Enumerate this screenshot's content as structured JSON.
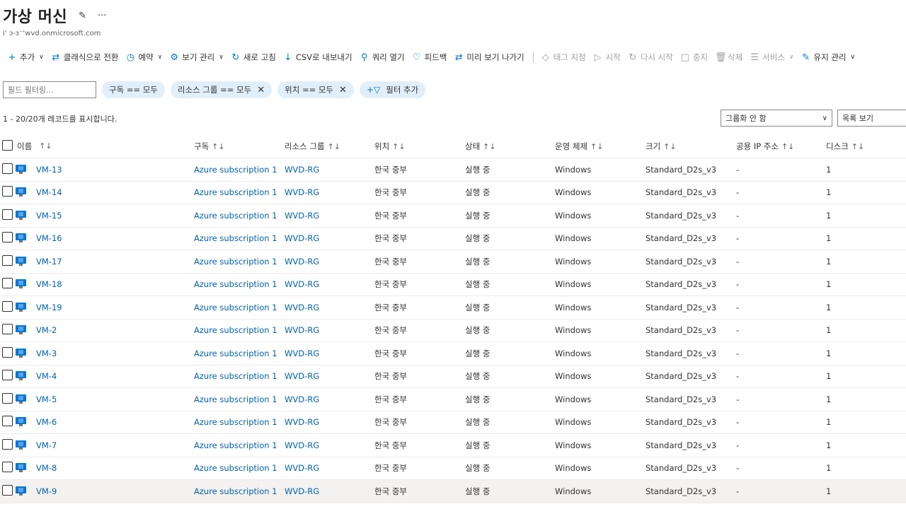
{
  "header": {
    "title": "가상 머신",
    "pin_icon": "pin-icon",
    "more": "···",
    "subtitle": "i' ɔ-ɜ⁻'wvd.onmicrosoft.com"
  },
  "toolbar": {
    "items": [
      {
        "icon": "+",
        "label": "추가",
        "dropdown": true,
        "disabled": false
      },
      {
        "icon": "⇄",
        "label": "클래식으로 전환",
        "dropdown": false,
        "disabled": false
      },
      {
        "icon": "◷",
        "label": "예약",
        "dropdown": true,
        "disabled": false
      },
      {
        "icon": "⚙",
        "label": "보기 관리",
        "dropdown": true,
        "disabled": false
      },
      {
        "icon": "↻",
        "label": "새로 고침",
        "dropdown": false,
        "disabled": false
      },
      {
        "icon": "↓",
        "label": "CSV로 내보내기",
        "dropdown": false,
        "disabled": false
      },
      {
        "icon": "⚲",
        "label": "쿼리 열기",
        "dropdown": false,
        "disabled": false
      },
      {
        "icon": "♡",
        "label": "피드백",
        "dropdown": false,
        "disabled": false
      },
      {
        "icon": "⇄",
        "label": "미리 보기 나가기",
        "dropdown": false,
        "disabled": false
      },
      {
        "icon": "◇",
        "label": "태그 지정",
        "dropdown": false,
        "disabled": true
      },
      {
        "icon": "▷",
        "label": "시작",
        "dropdown": false,
        "disabled": true
      },
      {
        "icon": "↻",
        "label": "다시 시작",
        "dropdown": false,
        "disabled": true
      },
      {
        "icon": "□",
        "label": "중지",
        "dropdown": false,
        "disabled": true
      },
      {
        "icon": "🗑",
        "label": "삭제",
        "dropdown": false,
        "disabled": true
      },
      {
        "icon": "☰",
        "label": "서비스",
        "dropdown": true,
        "disabled": true
      },
      {
        "icon": "✎",
        "label": "유지 관리",
        "dropdown": true,
        "disabled": false
      }
    ]
  },
  "filters": {
    "placeholder": "필드 필터링...",
    "pills": [
      {
        "label": "구독 == 모두",
        "removable": false
      },
      {
        "label": "리소스 그룹 == 모두",
        "removable": true
      },
      {
        "label": "위치 == 모두",
        "removable": true
      }
    ],
    "add_filter": "필터 추가"
  },
  "records_text": "1 - 20/20개 레코드를 표시합니다.",
  "group_by": "그룹화 안 함",
  "view_mode": "목록 보기",
  "columns": [
    "이름",
    "구독",
    "리소스 그룹",
    "위치",
    "상태",
    "운영 체제",
    "크기",
    "공용 IP 주소",
    "디스크"
  ],
  "sort_glyph": "↑↓",
  "rows": [
    {
      "name": "VM-13",
      "sub": "Azure subscription 1",
      "rg": "WVD-RG",
      "loc": "한국 중부",
      "status": "실행 중",
      "os": "Windows",
      "size": "Standard_D2s_v3",
      "ip": "-",
      "disk": "1"
    },
    {
      "name": "VM-14",
      "sub": "Azure subscription 1",
      "rg": "WVD-RG",
      "loc": "한국 중부",
      "status": "실행 중",
      "os": "Windows",
      "size": "Standard_D2s_v3",
      "ip": "-",
      "disk": "1"
    },
    {
      "name": "VM-15",
      "sub": "Azure subscription 1",
      "rg": "WVD-RG",
      "loc": "한국 중부",
      "status": "실행 중",
      "os": "Windows",
      "size": "Standard_D2s_v3",
      "ip": "-",
      "disk": "1"
    },
    {
      "name": "VM-16",
      "sub": "Azure subscription 1",
      "rg": "WVD-RG",
      "loc": "한국 중부",
      "status": "실행 중",
      "os": "Windows",
      "size": "Standard_D2s_v3",
      "ip": "-",
      "disk": "1"
    },
    {
      "name": "VM-17",
      "sub": "Azure subscription 1",
      "rg": "WVD-RG",
      "loc": "한국 중부",
      "status": "실행 중",
      "os": "Windows",
      "size": "Standard_D2s_v3",
      "ip": "-",
      "disk": "1"
    },
    {
      "name": "VM-18",
      "sub": "Azure subscription 1",
      "rg": "WVD-RG",
      "loc": "한국 중부",
      "status": "실행 중",
      "os": "Windows",
      "size": "Standard_D2s_v3",
      "ip": "-",
      "disk": "1"
    },
    {
      "name": "VM-19",
      "sub": "Azure subscription 1",
      "rg": "WVD-RG",
      "loc": "한국 중부",
      "status": "실행 중",
      "os": "Windows",
      "size": "Standard_D2s_v3",
      "ip": "-",
      "disk": "1"
    },
    {
      "name": "VM-2",
      "sub": "Azure subscription 1",
      "rg": "WVD-RG",
      "loc": "한국 중부",
      "status": "실행 중",
      "os": "Windows",
      "size": "Standard_D2s_v3",
      "ip": "-",
      "disk": "1"
    },
    {
      "name": "VM-3",
      "sub": "Azure subscription 1",
      "rg": "WVD-RG",
      "loc": "한국 중부",
      "status": "실행 중",
      "os": "Windows",
      "size": "Standard_D2s_v3",
      "ip": "-",
      "disk": "1"
    },
    {
      "name": "VM-4",
      "sub": "Azure subscription 1",
      "rg": "WVD-RG",
      "loc": "한국 중부",
      "status": "실행 중",
      "os": "Windows",
      "size": "Standard_D2s_v3",
      "ip": "-",
      "disk": "1"
    },
    {
      "name": "VM-5",
      "sub": "Azure subscription 1",
      "rg": "WVD-RG",
      "loc": "한국 중부",
      "status": "실행 중",
      "os": "Windows",
      "size": "Standard_D2s_v3",
      "ip": "-",
      "disk": "1"
    },
    {
      "name": "VM-6",
      "sub": "Azure subscription 1",
      "rg": "WVD-RG",
      "loc": "한국 중부",
      "status": "실행 중",
      "os": "Windows",
      "size": "Standard_D2s_v3",
      "ip": "-",
      "disk": "1"
    },
    {
      "name": "VM-7",
      "sub": "Azure subscription 1",
      "rg": "WVD-RG",
      "loc": "한국 중부",
      "status": "실행 중",
      "os": "Windows",
      "size": "Standard_D2s_v3",
      "ip": "-",
      "disk": "1"
    },
    {
      "name": "VM-8",
      "sub": "Azure subscription 1",
      "rg": "WVD-RG",
      "loc": "한국 중부",
      "status": "실행 중",
      "os": "Windows",
      "size": "Standard_D2s_v3",
      "ip": "-",
      "disk": "1"
    },
    {
      "name": "VM-9",
      "sub": "Azure subscription 1",
      "rg": "WVD-RG",
      "loc": "한국 중부",
      "status": "실행 중",
      "os": "Windows",
      "size": "Standard_D2s_v3",
      "ip": "-",
      "disk": "1"
    }
  ]
}
